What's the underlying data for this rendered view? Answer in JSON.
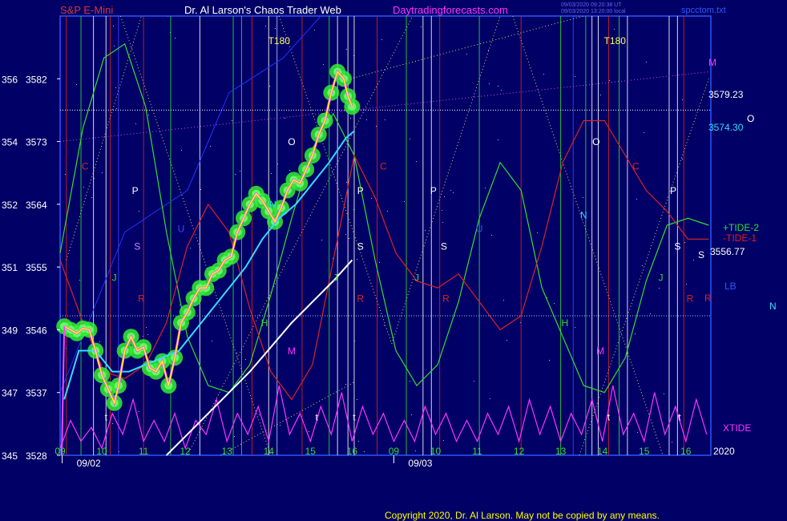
{
  "header": {
    "symbol": "S&P E-Mini",
    "site_title": "Dr. Al Larson's Chaos Trader Web",
    "site_url": "Daytradingforecasts.com",
    "stamp_line1": "09/03/2020 09:20:38 UT",
    "stamp_line2": "09/03/2020 13:20:00 local",
    "file_name": "spcctom.txt"
  },
  "footer": {
    "copyright": "Copyright 2020, Dr. Al Larson. May not be copied by any means.",
    "year": "2020"
  },
  "colors": {
    "background": "#000066",
    "price_yellow": "#ffff00",
    "ema_cyan": "#33ddff",
    "tide_green": "#33dd33",
    "tide_red": "#dd2222",
    "xtide_magenta": "#ff33ff",
    "glow_green": "#33ee33"
  },
  "chart_data": {
    "type": "line",
    "title": "S&P E-Mini",
    "ylim": [
      3528,
      3591
    ],
    "y_ticks": [
      {
        "left": "345",
        "price": "3528",
        "value": 3528
      },
      {
        "left": "347",
        "price": "3537",
        "value": 3537
      },
      {
        "left": "349",
        "price": "3546",
        "value": 3546
      },
      {
        "left": "351",
        "price": "3555",
        "value": 3555
      },
      {
        "left": "352",
        "price": "3564",
        "value": 3564
      },
      {
        "left": "354",
        "price": "3573",
        "value": 3573
      },
      {
        "left": "356",
        "price": "3582",
        "value": 3582
      }
    ],
    "x_range": [
      8.95,
      16.75
    ],
    "x_ticks": [
      {
        "label": "09",
        "hour": 9.0,
        "color": "#33dd33"
      },
      {
        "label": "10",
        "hour": 10.0,
        "color": "#33dd33"
      },
      {
        "label": "11",
        "hour": 11.0,
        "color": "#33dd33"
      },
      {
        "label": "12",
        "hour": 12.0,
        "color": "#33dd33"
      },
      {
        "label": "13",
        "hour": 13.0,
        "color": "#33dd33"
      },
      {
        "label": "14",
        "hour": 14.0,
        "color": "#33dd33"
      },
      {
        "label": "15",
        "hour": 15.0,
        "color": "#33dd33"
      },
      {
        "label": "16",
        "hour": 16.0,
        "color": "#33dd33"
      },
      {
        "label": "09",
        "hour": 17.0,
        "color": "#33dd33"
      },
      {
        "label": "10",
        "hour": 18.0,
        "color": "#33dd33"
      },
      {
        "label": "11",
        "hour": 19.0,
        "color": "#33dd33"
      },
      {
        "label": "12",
        "hour": 20.0,
        "color": "#33dd33"
      },
      {
        "label": "13",
        "hour": 21.0,
        "color": "#33dd33"
      },
      {
        "label": "14",
        "hour": 22.0,
        "color": "#33dd33"
      },
      {
        "label": "15",
        "hour": 23.0,
        "color": "#33dd33"
      },
      {
        "label": "16",
        "hour": 24.0,
        "color": "#33dd33"
      }
    ],
    "date_labels": [
      {
        "label": "09/02",
        "hour": 9.0
      },
      {
        "label": "09/03",
        "hour": 16.95
      }
    ],
    "price": {
      "name": "S&P E-Mini",
      "color": "#ffff00",
      "x": [
        9.05,
        9.2,
        9.35,
        9.5,
        9.65,
        9.8,
        9.95,
        10.1,
        10.25,
        10.35,
        10.5,
        10.65,
        10.8,
        10.95,
        11.1,
        11.25,
        11.4,
        11.55,
        11.7,
        11.85,
        12.0,
        12.15,
        12.3,
        12.45,
        12.6,
        12.75,
        12.9,
        13.05,
        13.2,
        13.35,
        13.5,
        13.65,
        13.8,
        13.95,
        14.1,
        14.25,
        14.4,
        14.55,
        14.7,
        14.85,
        15.0,
        15.15,
        15.3,
        15.45,
        15.6,
        15.75,
        15.85,
        15.95
      ],
      "y": [
        3546.5,
        3546.0,
        3545.5,
        3546.2,
        3546.0,
        3543.0,
        3539.5,
        3537.5,
        3535.5,
        3538.0,
        3543.0,
        3545.0,
        3543.0,
        3543.5,
        3540.5,
        3540.0,
        3541.5,
        3538.0,
        3542.0,
        3547.0,
        3548.5,
        3550.5,
        3552.0,
        3552.0,
        3554.0,
        3554.5,
        3556.0,
        3556.5,
        3560.0,
        3562.0,
        3564.0,
        3565.5,
        3564.5,
        3563.0,
        3561.5,
        3563.5,
        3566.0,
        3567.5,
        3567.0,
        3569.0,
        3571.0,
        3574.0,
        3576.0,
        3580.0,
        3583.0,
        3582.0,
        3579.5,
        3578.0
      ]
    },
    "ema": {
      "color": "#33ddff",
      "x": [
        9.05,
        9.4,
        9.8,
        10.2,
        10.6,
        11.0,
        11.4,
        11.8,
        12.2,
        12.6,
        13.0,
        13.4,
        13.8,
        14.2,
        14.6,
        15.0,
        15.4,
        15.8,
        16.0
      ],
      "y": [
        3536,
        3543,
        3543,
        3540,
        3540,
        3541,
        3542,
        3543,
        3546,
        3549,
        3552,
        3555,
        3559,
        3562,
        3564,
        3567,
        3570,
        3573.5,
        3574.5
      ]
    },
    "smooth_curve": {
      "color": "#ffffff",
      "x": [
        11.5,
        12.0,
        12.5,
        13.0,
        13.5,
        14.0,
        14.5,
        15.0,
        15.5,
        15.95
      ],
      "y": [
        3528,
        3531,
        3534,
        3537,
        3540,
        3543.5,
        3547,
        3550,
        3553,
        3556
      ]
    },
    "tides": {
      "plus_tide_2": {
        "name": "+TIDE-2",
        "color": "#33dd33",
        "x": [
          8.95,
          9.5,
          10.0,
          10.5,
          11.0,
          11.5,
          12.0,
          12.5,
          13.0,
          13.5,
          14.0,
          14.5,
          15.0,
          15.5,
          16.0,
          16.5,
          17.0,
          17.5,
          18.0,
          18.5,
          19.0,
          19.5,
          20.0,
          20.5,
          21.0,
          21.5,
          22.0,
          22.5,
          23.0,
          23.5,
          24.0,
          24.5
        ],
        "y": [
          3557,
          3575,
          3585,
          3587,
          3578,
          3560,
          3545,
          3538,
          3537,
          3541,
          3551,
          3562,
          3572,
          3577,
          3571,
          3556,
          3543,
          3538,
          3541,
          3550,
          3562,
          3570,
          3566,
          3552,
          3545,
          3538,
          3537,
          3542,
          3553,
          3561,
          3562,
          3561
        ]
      },
      "minus_tide_1": {
        "name": "-TIDE-1",
        "color": "#dd2222",
        "x": [
          8.95,
          9.5,
          10.0,
          10.5,
          11.0,
          11.5,
          12.0,
          12.5,
          13.0,
          13.5,
          14.0,
          14.5,
          15.0,
          15.5,
          16.0,
          16.5,
          17.0,
          17.5,
          18.0,
          18.5,
          19.0,
          19.5,
          20.0,
          20.5,
          21.0,
          21.5,
          22.0,
          22.5,
          23.0,
          23.5,
          24.0,
          24.5
        ],
        "y": [
          3556,
          3547,
          3540,
          3539,
          3541,
          3547,
          3558,
          3564,
          3560,
          3549,
          3540,
          3536,
          3541,
          3556,
          3571,
          3565,
          3557,
          3553,
          3552,
          3554,
          3550,
          3546,
          3548,
          3558,
          3570,
          3576,
          3576,
          3571,
          3566,
          3563,
          3559,
          3559
        ]
      },
      "xtide": {
        "name": "XTIDE",
        "color": "#ff33ff",
        "x": [
          8.95,
          9.2,
          9.45,
          9.7,
          9.95,
          10.2,
          10.45,
          10.7,
          10.95,
          11.2,
          11.45,
          11.7,
          11.95,
          12.2,
          12.45,
          12.7,
          12.95,
          13.2,
          13.45,
          13.7,
          13.95,
          14.2,
          14.45,
          14.7,
          14.95,
          15.2,
          15.45,
          15.7,
          15.95,
          16.2,
          16.45,
          16.7,
          16.95,
          17.2,
          17.45,
          17.7,
          17.95,
          18.2,
          18.45,
          18.7,
          18.95,
          19.2,
          19.45,
          19.7,
          19.95,
          20.2,
          20.45,
          20.7,
          20.95,
          21.2,
          21.45,
          21.7,
          21.95,
          22.2,
          22.45,
          22.7,
          22.95,
          23.2,
          23.45,
          23.7,
          23.95,
          24.2,
          24.45
        ],
        "y": [
          3529,
          3533,
          3530,
          3532,
          3529,
          3534,
          3531,
          3536,
          3530,
          3533,
          3530,
          3534,
          3529,
          3533,
          3531,
          3536,
          3530,
          3534,
          3531,
          3535,
          3530,
          3538,
          3531,
          3534,
          3530,
          3535,
          3531,
          3537,
          3530,
          3535,
          3531,
          3534,
          3530,
          3533,
          3530,
          3535,
          3531,
          3534,
          3530,
          3533,
          3530,
          3534,
          3531,
          3535,
          3530,
          3536,
          3531,
          3535,
          3530,
          3534,
          3531,
          3536,
          3530,
          3538,
          3531,
          3534,
          3530,
          3537,
          3531,
          3535,
          3530,
          3536,
          3531
        ]
      }
    },
    "levels": [
      {
        "name": "upper-dotted",
        "value": 3577.5,
        "color": "#ffffff"
      },
      {
        "name": "lower-dotted",
        "value": 3548.0,
        "color": "#99ccff"
      }
    ],
    "right_labels": {
      "m": "M",
      "level_1": "3579.23",
      "o": "O",
      "level_2": "3574.30",
      "plus_tide": "+TIDE-2",
      "minus_tide": "-TIDE-1",
      "s": "S",
      "level_3": "3556.77",
      "lb": "LB",
      "n": "N",
      "r": "R",
      "xtide": "XTIDE"
    },
    "markers": [
      {
        "text": "C",
        "hour": 9.55,
        "value": 3569,
        "color": "#dd2222"
      },
      {
        "text": "P",
        "hour": 10.75,
        "value": 3565.5,
        "color": "#ffffff"
      },
      {
        "text": "U",
        "hour": 11.85,
        "value": 3560,
        "color": "#4444ff"
      },
      {
        "text": "S",
        "hour": 10.8,
        "value": 3557.5,
        "color": "#cc88ff"
      },
      {
        "text": "J",
        "hour": 10.25,
        "value": 3553,
        "color": "#33dd33"
      },
      {
        "text": "R",
        "hour": 10.9,
        "value": 3550,
        "color": "#dd2222"
      },
      {
        "text": "t",
        "hour": 10.05,
        "value": 3533,
        "color": "#ffffff"
      },
      {
        "text": "T180",
        "hour": 14.2,
        "value": 3587,
        "color": "#ffff66"
      },
      {
        "text": "O",
        "hour": 14.5,
        "value": 3572.5,
        "color": "#ffffff"
      },
      {
        "text": "N",
        "hour": 14.05,
        "value": 3563.5,
        "color": "#33ddff"
      },
      {
        "text": "H",
        "hour": 13.85,
        "value": 3546.5,
        "color": "#33dd33"
      },
      {
        "text": "M",
        "hour": 14.5,
        "value": 3542.5,
        "color": "#ff33ff"
      },
      {
        "text": "t",
        "hour": 15.1,
        "value": 3533,
        "color": "#ffffff"
      },
      {
        "text": "J",
        "hour": 15.55,
        "value": 3553,
        "color": "#33dd33"
      },
      {
        "text": "P",
        "hour": 16.15,
        "value": 3565.5,
        "color": "#ffffff"
      },
      {
        "text": "C",
        "hour": 16.7,
        "value": 3569,
        "color": "#dd2222"
      },
      {
        "text": "S",
        "hour": 16.15,
        "value": 3557.5,
        "color": "#ffffff"
      },
      {
        "text": "R",
        "hour": 16.15,
        "value": 3550,
        "color": "#dd2222"
      },
      {
        "text": "t",
        "hour": 16.0,
        "value": 3533,
        "color": "#ffffff"
      },
      {
        "text": "P",
        "hour": 17.9,
        "value": 3565.5,
        "color": "#ffffff"
      },
      {
        "text": "S",
        "hour": 18.15,
        "value": 3557.5,
        "color": "#ffffff"
      },
      {
        "text": "J",
        "hour": 17.5,
        "value": 3553,
        "color": "#33dd33"
      },
      {
        "text": "R",
        "hour": 18.2,
        "value": 3550,
        "color": "#dd2222"
      },
      {
        "text": "U",
        "hour": 19.0,
        "value": 3560,
        "color": "#4444ff"
      },
      {
        "text": "N",
        "hour": 21.5,
        "value": 3562,
        "color": "#33ddff"
      },
      {
        "text": "H",
        "hour": 21.05,
        "value": 3546.5,
        "color": "#33dd33"
      },
      {
        "text": "T180",
        "hour": 22.25,
        "value": 3587,
        "color": "#ffff66"
      },
      {
        "text": "O",
        "hour": 21.8,
        "value": 3572.5,
        "color": "#ffffff"
      },
      {
        "text": "M",
        "hour": 21.9,
        "value": 3542.5,
        "color": "#ff33ff"
      },
      {
        "text": "C",
        "hour": 22.75,
        "value": 3569,
        "color": "#dd2222"
      },
      {
        "text": "t",
        "hour": 22.1,
        "value": 3533,
        "color": "#ffffff"
      },
      {
        "text": "P",
        "hour": 23.65,
        "value": 3565.5,
        "color": "#ffffff"
      },
      {
        "text": "J",
        "hour": 23.35,
        "value": 3553,
        "color": "#33dd33"
      },
      {
        "text": "S",
        "hour": 23.75,
        "value": 3557.5,
        "color": "#ffffff"
      },
      {
        "text": "R",
        "hour": 24.05,
        "value": 3550,
        "color": "#dd2222"
      },
      {
        "text": "t",
        "hour": 23.8,
        "value": 3533,
        "color": "#ffffff"
      }
    ],
    "vlines": [
      {
        "hour": 9.1,
        "color": "#dd2222"
      },
      {
        "hour": 9.45,
        "color": "#33dd33"
      },
      {
        "hour": 9.75,
        "color": "#ffffff"
      },
      {
        "hour": 10.05,
        "color": "#ffffff"
      },
      {
        "hour": 10.15,
        "color": "#dd2222"
      },
      {
        "hour": 10.35,
        "color": "#4444ff"
      },
      {
        "hour": 10.95,
        "color": "#dd2222"
      },
      {
        "hour": 11.6,
        "color": "#33dd33"
      },
      {
        "hour": 12.3,
        "color": "#ffffff"
      },
      {
        "hour": 13.1,
        "color": "#33dd33"
      },
      {
        "hour": 13.3,
        "color": "#33dd33"
      },
      {
        "hour": 13.55,
        "color": "#dd2222"
      },
      {
        "hour": 13.95,
        "color": "#ffffff"
      },
      {
        "hour": 14.15,
        "color": "#aaccff"
      },
      {
        "hour": 14.75,
        "color": "#dd2222"
      },
      {
        "hour": 15.4,
        "color": "#33dd33"
      },
      {
        "hour": 15.6,
        "color": "#ffffff"
      },
      {
        "hour": 15.85,
        "color": "#ffffff"
      },
      {
        "hour": 16.0,
        "color": "#ffffff"
      },
      {
        "hour": 16.55,
        "color": "#dd2222"
      },
      {
        "hour": 17.25,
        "color": "#33dd33"
      },
      {
        "hour": 17.65,
        "color": "#ffffff"
      },
      {
        "hour": 17.85,
        "color": "#ffffff"
      },
      {
        "hour": 18.05,
        "color": "#dd2222"
      },
      {
        "hour": 19.0,
        "color": "#33dd33"
      },
      {
        "hour": 20.0,
        "color": "#dd2222"
      },
      {
        "hour": 20.95,
        "color": "#33dd33"
      },
      {
        "hour": 21.25,
        "color": "#4444ff"
      },
      {
        "hour": 21.55,
        "color": "#33dd33"
      },
      {
        "hour": 21.7,
        "color": "#ffffff"
      },
      {
        "hour": 21.85,
        "color": "#ffffff"
      },
      {
        "hour": 22.1,
        "color": "#dd2222"
      },
      {
        "hour": 22.35,
        "color": "#33dd33"
      },
      {
        "hour": 22.55,
        "color": "#ffffff"
      },
      {
        "hour": 23.55,
        "color": "#ffffff"
      },
      {
        "hour": 23.75,
        "color": "#ffffff"
      },
      {
        "hour": 23.9,
        "color": "#dd2222"
      }
    ],
    "diag_lines": [
      {
        "color": "#dddd66",
        "x": [
          9.1,
          10.9
        ],
        "y": [
          3556,
          3591
        ]
      },
      {
        "color": "#dddd66",
        "x": [
          10.4,
          14.0
        ],
        "y": [
          3591,
          3528
        ]
      },
      {
        "color": "#dddd66",
        "x": [
          12.0,
          17.4
        ],
        "y": [
          3528,
          3591
        ]
      },
      {
        "color": "#dddd66",
        "x": [
          14.2,
          16.9
        ],
        "y": [
          3591,
          3544
        ]
      },
      {
        "color": "#dddd66",
        "x": [
          16.9,
          19.5
        ],
        "y": [
          3544,
          3591
        ]
      },
      {
        "color": "#dddd66",
        "x": [
          19.8,
          23.4
        ],
        "y": [
          3591,
          3528
        ]
      },
      {
        "color": "#dddd66",
        "x": [
          21.4,
          24.5
        ],
        "y": [
          3528,
          3582
        ]
      },
      {
        "color": "#dddd66",
        "x": [
          15.9,
          21.5
        ],
        "y": [
          3582,
          3591
        ]
      },
      {
        "color": "#dddd66",
        "x": [
          12.8,
          16.0
        ],
        "y": [
          3528,
          3538.5
        ]
      },
      {
        "color": "#dd44ff",
        "x": [
          8.95,
          24.5
        ],
        "y": [
          3573,
          3583
        ]
      },
      {
        "color": "#2233ff",
        "x": [
          8.95,
          10.5,
          12.0,
          13.0,
          14.3,
          15.2
        ],
        "y": [
          3537,
          3560,
          3566,
          3580,
          3585,
          3591
        ]
      }
    ]
  }
}
